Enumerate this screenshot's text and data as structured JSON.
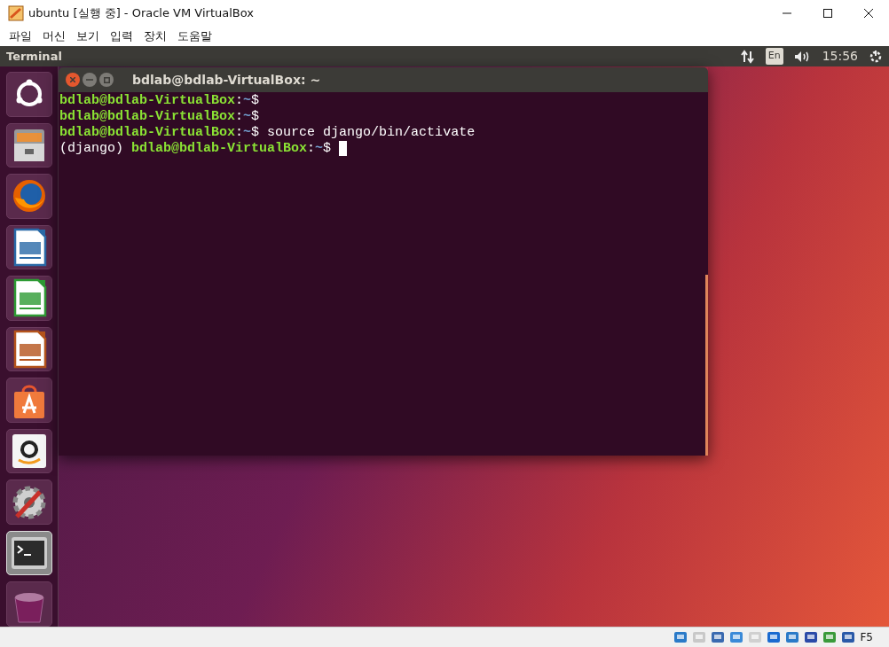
{
  "window": {
    "title": "ubuntu [실행 중] - Oracle VM VirtualBox"
  },
  "menu": [
    "파일",
    "머신",
    "보기",
    "입력",
    "장치",
    "도움말"
  ],
  "top_panel": {
    "app_name": "Terminal",
    "keyboard": "En",
    "clock": "15:56"
  },
  "launcher": [
    {
      "kind": "dash",
      "selected": false
    },
    {
      "kind": "files",
      "selected": false
    },
    {
      "kind": "browser",
      "selected": false
    },
    {
      "kind": "writer",
      "selected": false
    },
    {
      "kind": "calc",
      "selected": false
    },
    {
      "kind": "impress",
      "selected": false
    },
    {
      "kind": "store",
      "selected": false
    },
    {
      "kind": "shop",
      "selected": false
    },
    {
      "kind": "settings",
      "selected": false
    },
    {
      "kind": "terminal",
      "selected": true
    },
    {
      "kind": "trash",
      "selected": false
    }
  ],
  "terminal": {
    "title": "bdlab@bdlab-VirtualBox: ~",
    "lines": [
      {
        "user_host": "bdlab@bdlab-VirtualBox",
        "colon": ":",
        "path": "~",
        "symbol": "$",
        "cursor": false
      },
      {
        "user_host": "bdlab@bdlab-VirtualBox",
        "colon": ":",
        "path": "~",
        "symbol": "$",
        "cursor": false
      },
      {
        "user_host": "bdlab@bdlab-VirtualBox",
        "colon": ":",
        "path": "~",
        "symbol": "$",
        "command": "source django/bin/activate",
        "cursor": false
      },
      {
        "env": "(django)",
        "user_host": "bdlab@bdlab-VirtualBox",
        "colon": ":",
        "path": "~",
        "symbol": "$",
        "cursor": true
      }
    ]
  },
  "status_bar": {
    "host_key": "F5"
  }
}
